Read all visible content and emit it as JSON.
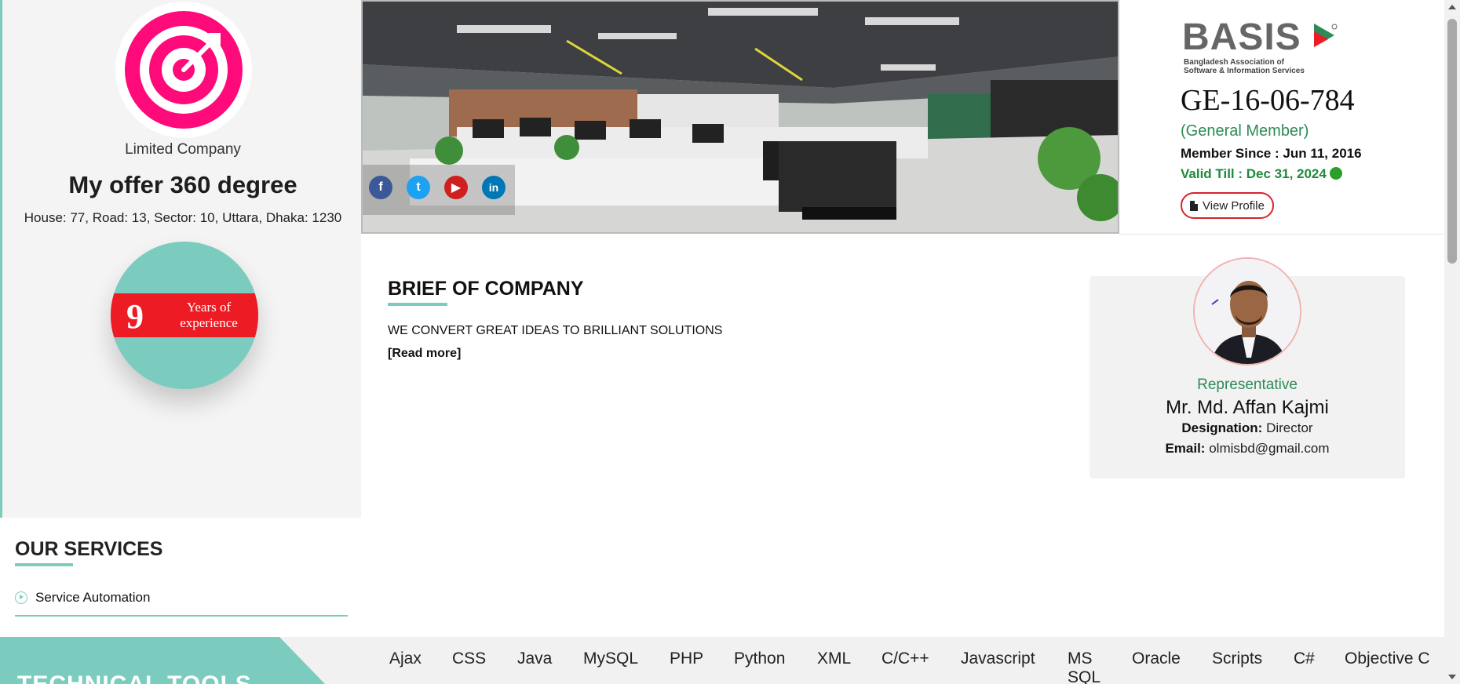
{
  "profile": {
    "logo_icon": "target-dartboard-icon",
    "company_type": "Limited Company",
    "company_name": "My offer 360 degree",
    "address": "House: 77, Road: 13, Sector: 10, Uttara, Dhaka: 1230",
    "experience_years": "9",
    "experience_label": "Years of experience"
  },
  "banner": {
    "social": [
      {
        "name": "facebook",
        "glyph": "f"
      },
      {
        "name": "twitter",
        "glyph": "t"
      },
      {
        "name": "youtube",
        "glyph": "▶"
      },
      {
        "name": "linkedin",
        "glyph": "in"
      }
    ]
  },
  "membership": {
    "org_name": "BASIS",
    "org_full": "Bangladesh Association of Software & Information Services",
    "org_full_line1": "Bangladesh Association of",
    "org_full_line2": "Software & Information Services",
    "registration_no": "GE-16-06-784",
    "member_type": "(General Member)",
    "member_since": "Member Since : Jun 11, 2016",
    "valid_till": "Valid Till : Dec 31, 2024",
    "view_profile_label": "View Profile"
  },
  "brief": {
    "title": "BRIEF OF COMPANY",
    "text": "WE CONVERT GREAT IDEAS TO BRILLIANT SOLUTIONS",
    "read_more": "[Read more]"
  },
  "representative": {
    "role": "Representative",
    "name": "Mr. Md. Affan Kajmi",
    "designation_label": "Designation:",
    "designation": "Director",
    "email_label": "Email:",
    "email": "olmisbd@gmail.com"
  },
  "services": {
    "title": "OUR SERVICES",
    "items": [
      "Service Automation"
    ]
  },
  "tools": {
    "title": "TECHNICAL TOOLS",
    "items": [
      "Ajax",
      "CSS",
      "Java",
      "MySQL",
      "PHP",
      "Python",
      "XML",
      "C/C++",
      "Javascript",
      "MS SQL",
      "Oracle",
      "Scripts",
      "C#",
      "Objective C"
    ]
  },
  "colors": {
    "accent_teal": "#7ccbbf",
    "brand_red": "#ed1c24",
    "success_green": "#2e8b57",
    "logo_pink": "#ff0a7a"
  }
}
